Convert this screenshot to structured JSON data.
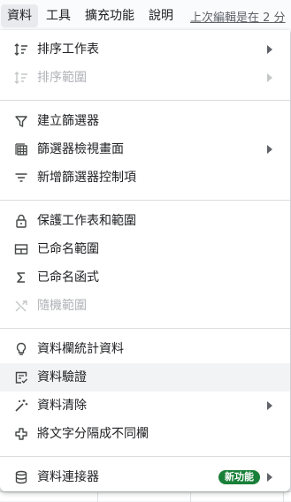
{
  "menubar": {
    "items": [
      "資料",
      "工具",
      "擴充功能",
      "說明"
    ],
    "last_edit": "上次編輯是在 2 分"
  },
  "menu": {
    "sort_sheet": "排序工作表",
    "sort_range": "排序範圍",
    "create_filter": "建立篩選器",
    "filter_views": "篩選器檢視畫面",
    "add_slicer": "新增篩選器控制項",
    "protect": "保護工作表和範圍",
    "named_ranges": "已命名範圍",
    "named_functions": "已命名函式",
    "randomize_range": "隨機範圍",
    "column_stats": "資料欄統計資料",
    "data_validation": "資料驗證",
    "data_cleanup": "資料清除",
    "split_text": "將文字分隔成不同欄",
    "data_connectors": "資料連接器",
    "new_badge": "新功能"
  },
  "colors": {
    "badge": "#188038",
    "hover": "#f1f3f4",
    "disabled_text": "#b0b3b8",
    "divider": "#dadce0"
  },
  "icons": [
    "sort-icon",
    "sort-range-icon",
    "filter-icon",
    "filter-views-icon",
    "slicer-icon",
    "lock-icon",
    "named-range-icon",
    "sigma-icon",
    "shuffle-icon",
    "lightbulb-icon",
    "validation-icon",
    "magic-wand-icon",
    "split-columns-icon",
    "database-icon"
  ]
}
